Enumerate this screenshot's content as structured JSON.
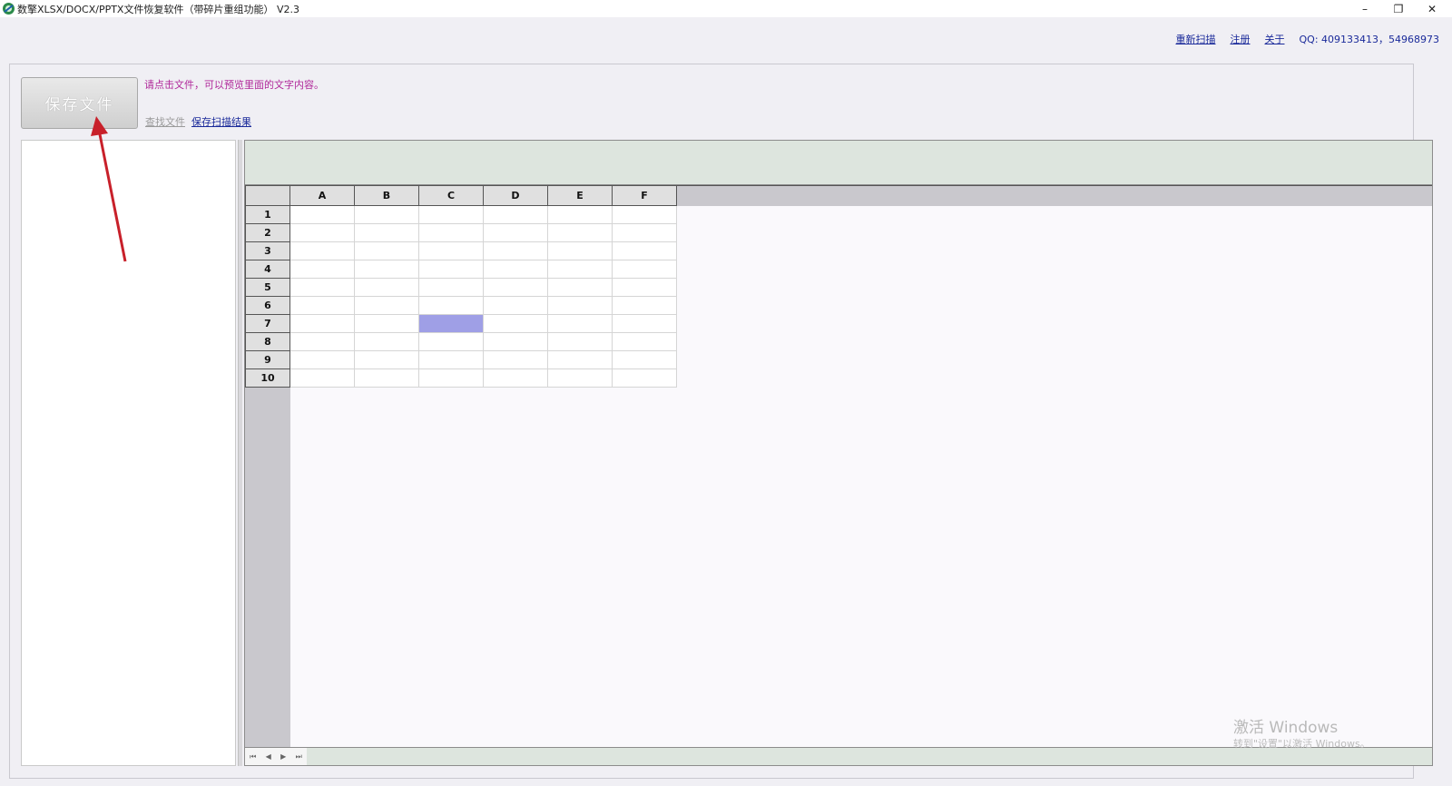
{
  "window": {
    "title": "数擎XLSX/DOCX/PPTX文件恢复软件（带碎片重组功能） V2.3",
    "minimize": "–",
    "maximize": "❐",
    "close": "✕"
  },
  "top_links": {
    "rescan": "重新扫描",
    "register": "注册",
    "about": "关于",
    "qq": "QQ: 409133413，54968973"
  },
  "toolbar": {
    "save_file_label": "保存文件",
    "hint": "请点击文件，可以预览里面的文字内容。",
    "find_file": "查找文件",
    "save_scan_results": "保存扫描结果"
  },
  "grid": {
    "columns": [
      "A",
      "B",
      "C",
      "D",
      "E",
      "F"
    ],
    "rows": [
      "1",
      "2",
      "3",
      "4",
      "5",
      "6",
      "7",
      "8",
      "9",
      "10"
    ],
    "selected_cell": "C7"
  },
  "sheet_nav": {
    "first": "⏮",
    "prev": "◀",
    "next": "▶",
    "last": "⏭"
  },
  "watermark": {
    "title": "激活 Windows",
    "subtitle": "转到\"设置\"以激活 Windows。"
  },
  "colors": {
    "hint": "#b0289a",
    "link": "#1a2a9a",
    "selected_cell": "#9f9fe6",
    "annotation_arrow": "#c8202a"
  }
}
